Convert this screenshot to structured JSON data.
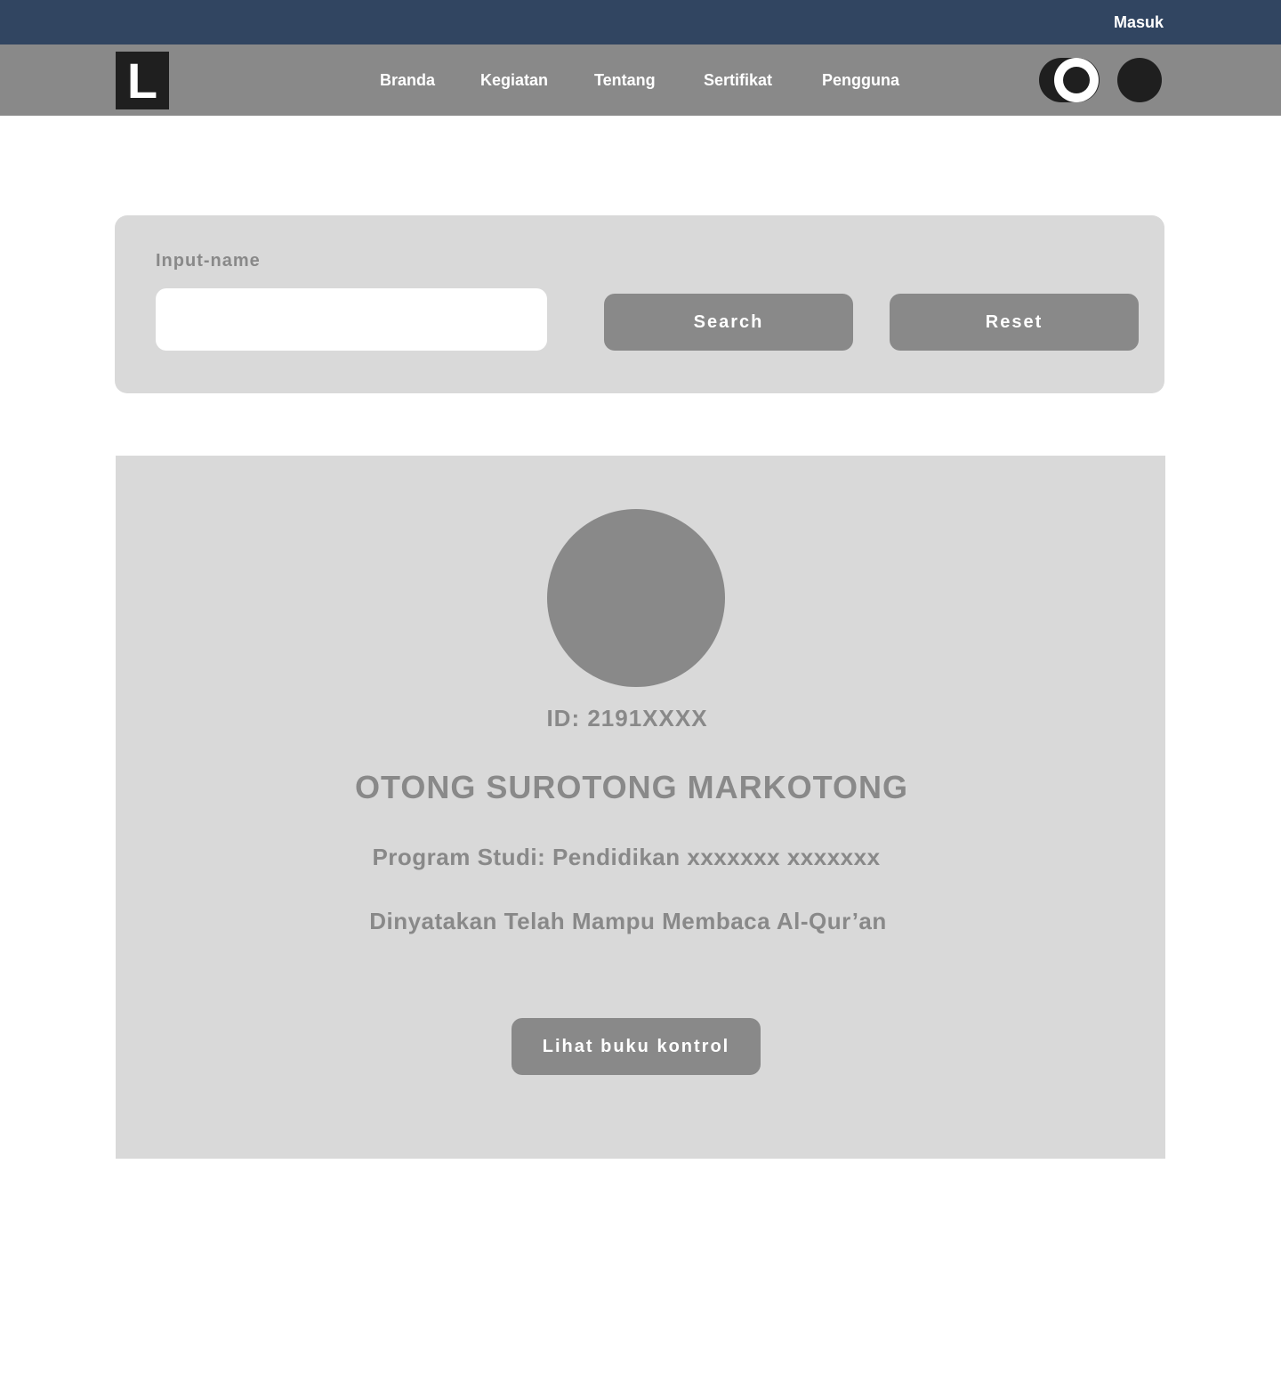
{
  "topbar": {
    "login_label": "Masuk",
    "background": "#314561"
  },
  "navbar": {
    "logo_letter": "L",
    "items": [
      {
        "label": "Branda"
      },
      {
        "label": "Kegiatan"
      },
      {
        "label": "Tentang"
      },
      {
        "label": "Sertifikat"
      },
      {
        "label": "Pengguna"
      }
    ],
    "theme_toggle_icon": "theme-toggle-icon",
    "user_avatar_icon": "user-avatar-icon"
  },
  "search": {
    "label": "Input-name",
    "input_value": "",
    "input_placeholder": "",
    "search_label": "Search",
    "reset_label": "Reset"
  },
  "profile": {
    "photo_icon": "profile-photo-placeholder",
    "id_text": "ID: 2191XXXX",
    "name": "OTONG SUROTONG MARKOTONG",
    "program_text": "Program Studi:  Pendidikan xxxxxxx xxxxxxx",
    "statement": "Dinyatakan Telah Mampu Membaca Al-Qur’an",
    "control_book_label": "Lihat buku kontrol"
  },
  "colors": {
    "accent_gray": "#898989",
    "panel_gray": "#d9d9d9",
    "dark": "#1f1f1f"
  }
}
